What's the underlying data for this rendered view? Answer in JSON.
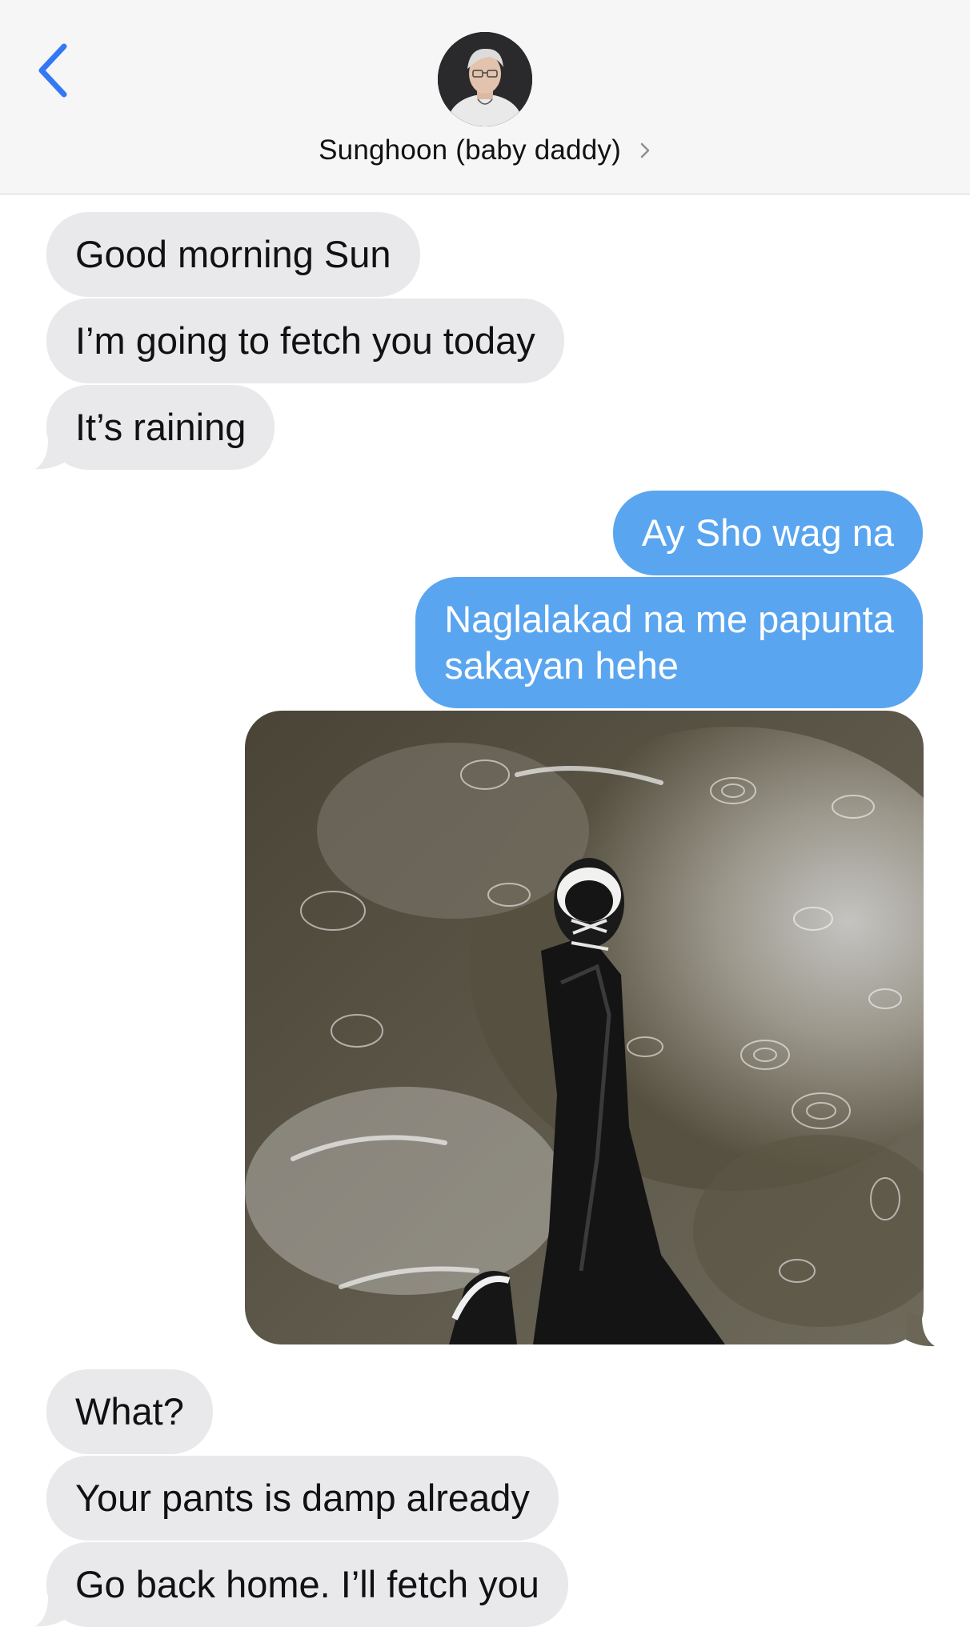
{
  "header": {
    "contact_name": "Sunghoon (baby daddy)"
  },
  "messages": [
    {
      "side": "in",
      "text": "Good morning Sun"
    },
    {
      "side": "in",
      "text": "I’m going to fetch you today"
    },
    {
      "side": "in",
      "text": "It’s raining"
    },
    {
      "side": "out",
      "text": "Ay Sho wag na"
    },
    {
      "side": "out",
      "lines": [
        "Naglalakad na me papunta",
        "sakayan hehe"
      ]
    },
    {
      "side": "out",
      "type": "photo"
    },
    {
      "side": "in",
      "text": "What?"
    },
    {
      "side": "in",
      "text": "Your pants is damp already"
    },
    {
      "side": "in",
      "text": "Go back home. I’ll fetch you"
    }
  ],
  "colors": {
    "incoming_bubble": "#e9e9eb",
    "outgoing_bubble": "#5aa5f0",
    "accent": "#3478f6"
  }
}
